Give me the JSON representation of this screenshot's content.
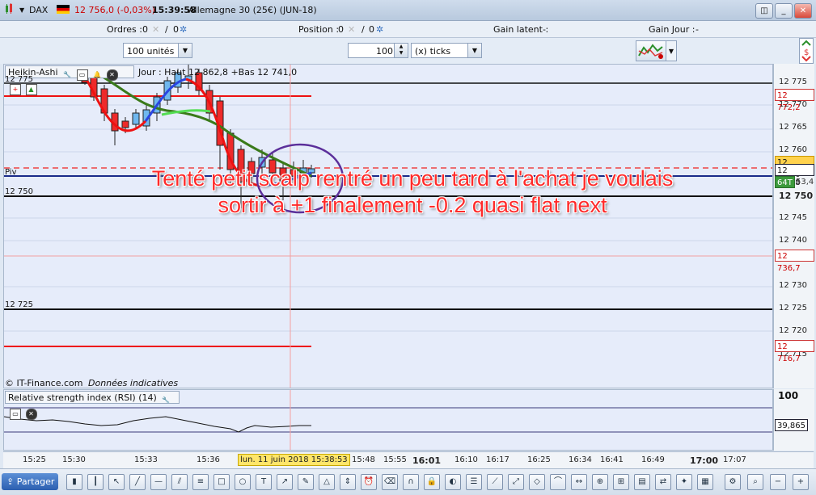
{
  "titlebar": {
    "instrument": "DAX",
    "price_change": "12 756,0 (-0,03%)",
    "time": "15:39:58",
    "contract": "Allemagne 30 (25€) (JUN-18)"
  },
  "infobar": {
    "orders_label": "Ordres :",
    "orders_value": "0",
    "orders_zero": "0",
    "position_label": "Position :",
    "position_value": "0",
    "position_zero": "0",
    "latent_label": "Gain latent :",
    "latent_value": "-",
    "day_label": "Gain Jour :",
    "day_value": "-"
  },
  "toolbar": {
    "units_select": "100 unités",
    "ticks_value": "100",
    "ticks_unit": "(x) ticks"
  },
  "chart": {
    "indicator_name": "Heikin-Ashi",
    "day_info": "Jour : Haut 12 862,8 +Bas 12 741,0",
    "pivot_label": "Piv",
    "level_12750_label": "12 750",
    "level_12725_label": "12 725",
    "level_top_label": "12 775",
    "copyright": "© IT-Finance.com",
    "data_note": "Données indicatives",
    "annotation_line1": "Tenté petit scalp rentré un peu tard à l'achat je voulais",
    "annotation_line2": "sortir à +1 finalement -0.2 quasi flat next"
  },
  "yaxis": {
    "ticks": [
      "12 775",
      "12 770",
      "12 765",
      "12 760",
      "12 750",
      "12 745",
      "12 740",
      "12 730",
      "12 725",
      "12 720",
      "12 715"
    ],
    "boxes": {
      "red_top": "12 772,2",
      "current": "12 756,0",
      "pivot": "12 755,8",
      "volume_tag": "64T",
      "volume_value": "53,4",
      "red_mid": "12 736,7",
      "red_low": "12 716,7"
    }
  },
  "rsi": {
    "title": "Relative strength index (RSI) (14)",
    "axis_top": "100",
    "value": "39,865"
  },
  "timeaxis": {
    "labels": [
      "15:25",
      "15:30",
      "15:33",
      "15:36",
      "15:48",
      "15:55",
      "16:01",
      "16:10",
      "16:17",
      "16:25",
      "16:34",
      "16:41",
      "16:49",
      "17:00",
      "17:07"
    ],
    "cursor_label": "lun. 11 juin 2018 15:38:53"
  },
  "bottombar": {
    "share_label": "Partager"
  },
  "colors": {
    "bull_candle": "#6fb7ee",
    "bear_candle": "#ee2a2a",
    "ma_green": "#3a7a1a",
    "annotation_red": "#ff2a2a",
    "circle": "#5b2e9a"
  }
}
